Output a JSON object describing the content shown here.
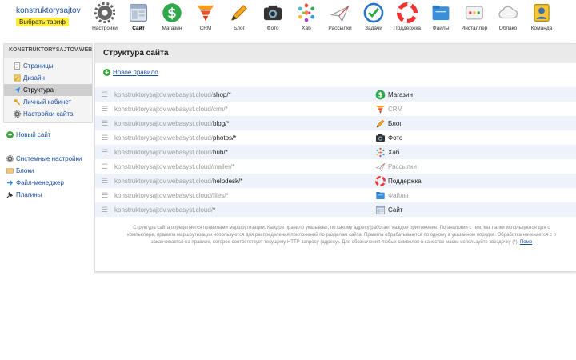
{
  "account": {
    "name": "konstruktorysajtov",
    "tariff_button": "Выбрать тариф"
  },
  "apps": [
    {
      "label": "Настройки",
      "icon": "gear-icon"
    },
    {
      "label": "Сайт",
      "icon": "site-icon",
      "active": true
    },
    {
      "label": "Магазин",
      "icon": "shop-icon"
    },
    {
      "label": "CRM",
      "icon": "crm-icon"
    },
    {
      "label": "Блог",
      "icon": "blog-pencil-icon"
    },
    {
      "label": "Фото",
      "icon": "camera-icon"
    },
    {
      "label": "Хаб",
      "icon": "hub-icon"
    },
    {
      "label": "Рассылки",
      "icon": "mailer-icon"
    },
    {
      "label": "Задачи",
      "icon": "tasks-icon"
    },
    {
      "label": "Поддержка",
      "icon": "lifebuoy-icon"
    },
    {
      "label": "Файлы",
      "icon": "files-icon"
    },
    {
      "label": "Инсталлер",
      "icon": "installer-icon"
    },
    {
      "label": "Облако",
      "icon": "cloud-icon"
    },
    {
      "label": "Команда",
      "icon": "team-icon"
    }
  ],
  "sidebar": {
    "site_name": "KONSTRUKTORYSAJTOV.WEB...",
    "items": [
      {
        "label": "Страницы",
        "icon": "pages-icon"
      },
      {
        "label": "Дизайн",
        "icon": "design-icon"
      },
      {
        "label": "Структура",
        "icon": "structure-icon",
        "active": true
      },
      {
        "label": "Личный кабинет",
        "icon": "key-icon"
      },
      {
        "label": "Настройки сайта",
        "icon": "gear-icon"
      }
    ],
    "new_site": "Новый сайт",
    "tools": [
      {
        "label": "Системные настройки",
        "icon": "gear-icon"
      },
      {
        "label": "Блоки",
        "icon": "blocks-icon"
      },
      {
        "label": "Файл-менеджер",
        "icon": "file-manager-icon"
      },
      {
        "label": "Плагины",
        "icon": "plugin-icon"
      }
    ]
  },
  "main": {
    "title": "Структура сайта",
    "new_rule": "Новое правило",
    "rules": [
      {
        "prefix": "konstruktorysajtov.webasyst.cloud/",
        "path": "shop/*",
        "app": "Магазин",
        "icon": "shop-icon",
        "dim": false
      },
      {
        "prefix": "konstruktorysajtov.webasyst.cloud/",
        "path": "crm/*",
        "app": "CRM",
        "icon": "crm-icon",
        "dim": true
      },
      {
        "prefix": "konstruktorysajtov.webasyst.cloud/",
        "path": "blog/*",
        "app": "Блог",
        "icon": "blog-pencil-icon",
        "dim": false
      },
      {
        "prefix": "konstruktorysajtov.webasyst.cloud/",
        "path": "photos/*",
        "app": "Фото",
        "icon": "camera-icon",
        "dim": false
      },
      {
        "prefix": "konstruktorysajtov.webasyst.cloud/",
        "path": "hub/*",
        "app": "Хаб",
        "icon": "hub-icon",
        "dim": false
      },
      {
        "prefix": "konstruktorysajtov.webasyst.cloud/",
        "path": "mailer/*",
        "app": "Рассылки",
        "icon": "mailer-icon",
        "dim": true
      },
      {
        "prefix": "konstruktorysajtov.webasyst.cloud/",
        "path": "helpdesk/*",
        "app": "Поддержка",
        "icon": "lifebuoy-icon",
        "dim": false
      },
      {
        "prefix": "konstruktorysajtov.webasyst.cloud/",
        "path": "files/*",
        "app": "Файлы",
        "icon": "files-icon",
        "dim": true
      },
      {
        "prefix": "konstruktorysajtov.webasyst.cloud/",
        "path": "*",
        "app": "Сайт",
        "icon": "site-icon",
        "dim": false
      }
    ],
    "description_lines": [
      "Структура сайта определяется правилами маршрутизации. Каждое правило указывает, по какому адресу работает каждое приложение. По аналогии с тем, как папки используются для о",
      "компьютере, правила маршрутизации используются для распределения приложений по разделам сайта. Правила обрабатываются по одному в указанном порядке. Обработка начинается с п",
      "заканчивается на правиле, которое соответствует текущему HTTP-запросу (адресу). Для обозначения любых символов в качестве маски используйте звездочку (*)."
    ],
    "help_link": "Помо"
  },
  "colors": {
    "link": "#1a4fa0",
    "active_bg": "#cfcfcf",
    "row_alt": "#eef3fb",
    "tariff": "#ffeb3b"
  }
}
